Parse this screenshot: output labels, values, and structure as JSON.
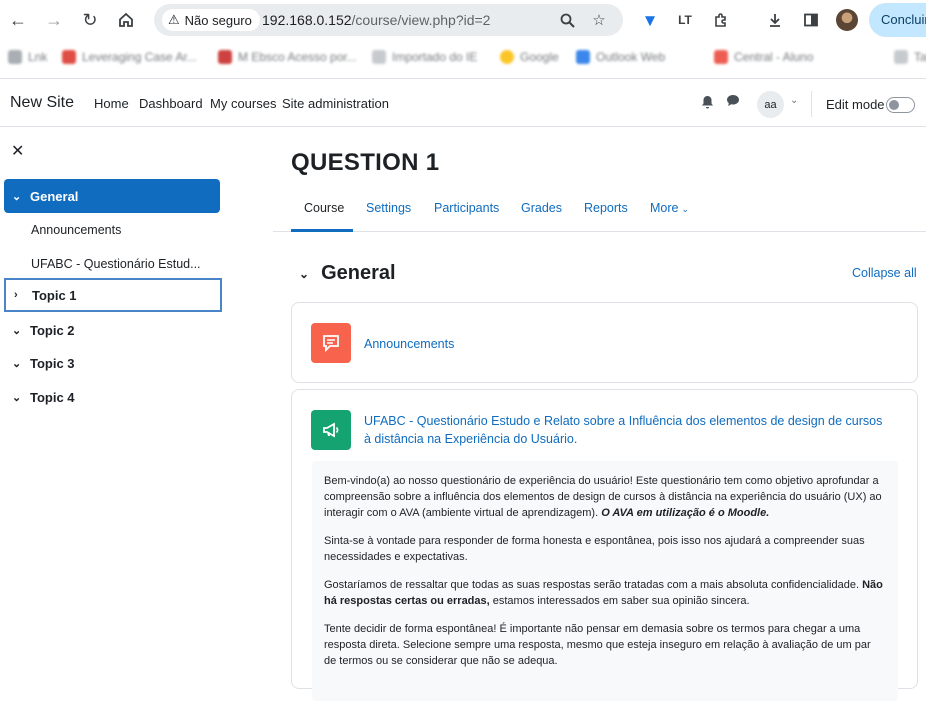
{
  "browser": {
    "security_label": "Não seguro",
    "url_host": "192.168.0.152",
    "url_path": "/course/view.php?id=2",
    "conclude_label": "Concluir",
    "bookmarks": [
      "Lnk",
      "Leveraging Case Ar...",
      "M Ebsco Acesso por...",
      "Importado do IE",
      "Google",
      "Outlook Web",
      "Central - Aluno",
      "Tab"
    ]
  },
  "navbar": {
    "site_name": "New Site",
    "links": [
      "Home",
      "Dashboard",
      "My courses",
      "Site administration"
    ],
    "user_initials": "aa",
    "edit_mode_label": "Edit mode"
  },
  "drawer": {
    "close_glyph": "✕",
    "sections": [
      {
        "label": "General",
        "expanded": true,
        "activities": [
          "Announcements",
          "UFABC - Questionário Estud..."
        ]
      },
      {
        "label": "Topic 1",
        "expanded": false
      },
      {
        "label": "Topic 2",
        "expanded": true
      },
      {
        "label": "Topic 3",
        "expanded": true
      },
      {
        "label": "Topic 4",
        "expanded": true
      }
    ]
  },
  "main": {
    "course_title": "QUESTION 1",
    "tabs": [
      "Course",
      "Settings",
      "Participants",
      "Grades",
      "Reports",
      "More"
    ],
    "section_title": "General",
    "collapse_all": "Collapse all",
    "announcements_link": "Announcements",
    "quiz_link": "UFABC - Questionário Estudo e Relato sobre a Influência dos elementos de design de cursos à distância na Experiência do Usuário.",
    "description": {
      "p1_text": "Bem-vindo(a) ao nosso questionário de experiência do usuário! Este questionário tem como objetivo aprofundar a compreensão sobre a influência dos elementos de design de cursos à distância na experiência do usuário (UX) ao interagir com o AVA (ambiente virtual de aprendizagem). ",
      "p1_emphasis": "O AVA em utilização é o Moodle.",
      "p2": "Sinta-se à vontade para responder de forma honesta e espontânea, pois isso nos ajudará a compreender suas necessidades e expectativas.",
      "p3_text": "Gostaríamos de ressaltar que todas as suas respostas serão tratadas com a mais absoluta confidencialidade. ",
      "p3_bold": "Não há respostas certas ou erradas,",
      "p3_tail": " estamos interessados em saber sua opinião sincera.",
      "p4": "Tente decidir de forma espontânea! É importante não pensar em demasia sobre os termos para chegar a uma resposta direta. Selecione sempre uma resposta, mesmo que esteja inseguro em relação à avaliação de um par de termos ou se considerar que não se adequa."
    }
  },
  "colors": {
    "primary": "#0f6cbf",
    "announcement_icon": "#f7634d",
    "quiz_icon": "#15a471",
    "focus_outline": "#4985c8"
  },
  "icons": {
    "back": "arrow-left-icon",
    "forward": "arrow-right-icon",
    "reload": "reload-icon",
    "home": "home-icon",
    "warning": "warning-icon",
    "zoom": "magnifier-icon",
    "star": "star-icon",
    "notifications": "bell-icon",
    "messages": "chat-bubble-icon"
  }
}
